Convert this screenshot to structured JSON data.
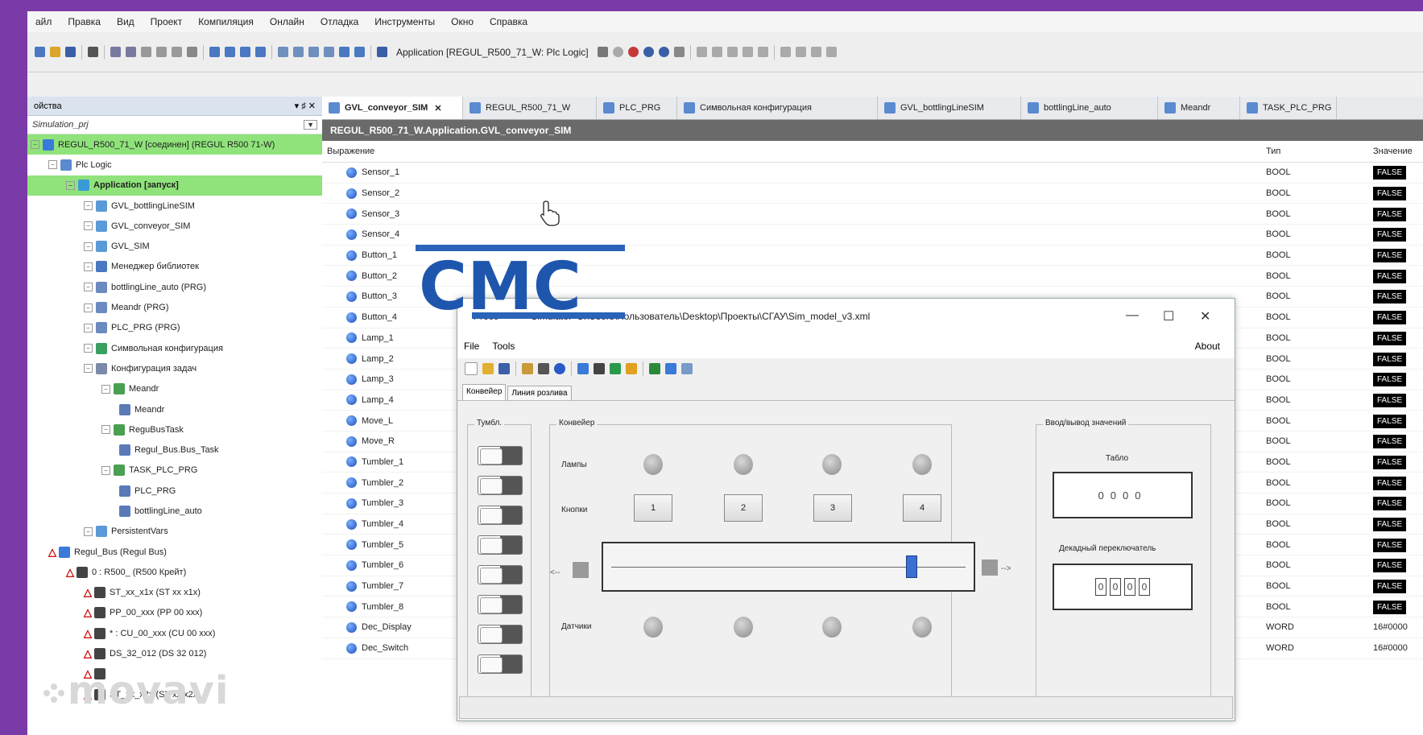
{
  "menu": [
    "айл",
    "Правка",
    "Вид",
    "Проект",
    "Компиляция",
    "Онлайн",
    "Отладка",
    "Инструменты",
    "Окно",
    "Справка"
  ],
  "toolbar": {
    "app_combo": "Application [REGUL_R500_71_W: Plc Logic]"
  },
  "left_panel": {
    "title": "ойства",
    "controls": "▾ ♯ ✕",
    "project": "Simulation_prj",
    "tree": [
      {
        "label": "REGUL_R500_71_W [соединен] (REGUL R500 71-W)",
        "indent": 0,
        "hl": true,
        "bold": false,
        "icon": "device"
      },
      {
        "label": "Plc Logic",
        "indent": 1,
        "hl": false,
        "bold": false,
        "icon": "plc"
      },
      {
        "label": "Application [запуск]",
        "indent": 2,
        "hl": true,
        "bold": true,
        "icon": "gear"
      },
      {
        "label": "GVL_bottlingLineSIM",
        "indent": 3,
        "hl": false,
        "bold": false,
        "icon": "gvl"
      },
      {
        "label": "GVL_conveyor_SIM",
        "indent": 3,
        "hl": false,
        "bold": false,
        "icon": "gvl"
      },
      {
        "label": "GVL_SIM",
        "indent": 3,
        "hl": false,
        "bold": false,
        "icon": "gvl"
      },
      {
        "label": "Менеджер библиотек",
        "indent": 3,
        "hl": false,
        "bold": false,
        "icon": "lib"
      },
      {
        "label": "bottlingLine_auto (PRG)",
        "indent": 3,
        "hl": false,
        "bold": false,
        "icon": "prg"
      },
      {
        "label": "Meandr (PRG)",
        "indent": 3,
        "hl": false,
        "bold": false,
        "icon": "prg"
      },
      {
        "label": "PLC_PRG (PRG)",
        "indent": 3,
        "hl": false,
        "bold": false,
        "icon": "prg"
      },
      {
        "label": "Символьная конфигурация",
        "indent": 3,
        "hl": false,
        "bold": false,
        "icon": "sym"
      },
      {
        "label": "Конфигурация задач",
        "indent": 3,
        "hl": false,
        "bold": false,
        "icon": "task"
      },
      {
        "label": "Meandr",
        "indent": 4,
        "hl": false,
        "bold": false,
        "icon": "taskitem"
      },
      {
        "label": "Meandr",
        "indent": 5,
        "hl": false,
        "bold": false,
        "icon": "call"
      },
      {
        "label": "ReguBusTask",
        "indent": 4,
        "hl": false,
        "bold": false,
        "icon": "taskitem"
      },
      {
        "label": "Regul_Bus.Bus_Task",
        "indent": 5,
        "hl": false,
        "bold": false,
        "icon": "call"
      },
      {
        "label": "TASK_PLC_PRG",
        "indent": 4,
        "hl": false,
        "bold": false,
        "icon": "taskitem"
      },
      {
        "label": "PLC_PRG",
        "indent": 5,
        "hl": false,
        "bold": false,
        "icon": "call"
      },
      {
        "label": "bottlingLine_auto",
        "indent": 5,
        "hl": false,
        "bold": false,
        "icon": "call"
      },
      {
        "label": "PersistentVars",
        "indent": 3,
        "hl": false,
        "bold": false,
        "icon": "gvl"
      },
      {
        "label": "Regul_Bus (Regul Bus)",
        "indent": 1,
        "hl": false,
        "bold": false,
        "icon": "warnbus"
      },
      {
        "label": "0 : R500_ (R500 Крейт)",
        "indent": 2,
        "hl": false,
        "bold": false,
        "icon": "warnmod"
      },
      {
        "label": "ST_xx_x1x (ST xx x1x)",
        "indent": 3,
        "hl": false,
        "bold": false,
        "icon": "warnmod"
      },
      {
        "label": "PP_00_xxx (PP 00 xxx)",
        "indent": 3,
        "hl": false,
        "bold": false,
        "icon": "warnmod"
      },
      {
        "label": "* : CU_00_xxx (CU 00 xxx)",
        "indent": 3,
        "hl": false,
        "bold": false,
        "icon": "warnmod"
      },
      {
        "label": "DS_32_012 (DS 32 012)",
        "indent": 3,
        "hl": false,
        "bold": false,
        "icon": "warnmod"
      },
      {
        "label": "",
        "indent": 3,
        "hl": false,
        "bold": false,
        "icon": "warnmod"
      },
      {
        "label": "ST_xx_x2x (ST xx x2x)",
        "indent": 3,
        "hl": false,
        "bold": false,
        "icon": "warnmod"
      }
    ]
  },
  "tabs": [
    {
      "label": "GVL_conveyor_SIM",
      "active": true,
      "close": "✕",
      "w": 175
    },
    {
      "label": "REGUL_R500_71_W",
      "active": false,
      "close": "",
      "w": 166
    },
    {
      "label": "PLC_PRG",
      "active": false,
      "close": "",
      "w": 100
    },
    {
      "label": "Символьная конфигурация",
      "active": false,
      "close": "",
      "w": 249
    },
    {
      "label": "GVL_bottlingLineSIM",
      "active": false,
      "close": "",
      "w": 178
    },
    {
      "label": "bottlingLine_auto",
      "active": false,
      "close": "",
      "w": 170
    },
    {
      "label": "Meandr",
      "active": false,
      "close": "",
      "w": 102
    },
    {
      "label": "TASK_PLC_PRG",
      "active": false,
      "close": "",
      "w": 120
    }
  ],
  "path": "REGUL_R500_71_W.Application.GVL_conveyor_SIM",
  "columns": {
    "expr": "Выражение",
    "type": "Тип",
    "value": "Значение"
  },
  "variables": [
    {
      "name": "Sensor_1",
      "type": "BOOL",
      "value": "FALSE"
    },
    {
      "name": "Sensor_2",
      "type": "BOOL",
      "value": "FALSE"
    },
    {
      "name": "Sensor_3",
      "type": "BOOL",
      "value": "FALSE"
    },
    {
      "name": "Sensor_4",
      "type": "BOOL",
      "value": "FALSE"
    },
    {
      "name": "Button_1",
      "type": "BOOL",
      "value": "FALSE"
    },
    {
      "name": "Button_2",
      "type": "BOOL",
      "value": "FALSE"
    },
    {
      "name": "Button_3",
      "type": "BOOL",
      "value": "FALSE"
    },
    {
      "name": "Button_4",
      "type": "BOOL",
      "value": "FALSE"
    },
    {
      "name": "Lamp_1",
      "type": "BOOL",
      "value": "FALSE"
    },
    {
      "name": "Lamp_2",
      "type": "BOOL",
      "value": "FALSE"
    },
    {
      "name": "Lamp_3",
      "type": "BOOL",
      "value": "FALSE"
    },
    {
      "name": "Lamp_4",
      "type": "BOOL",
      "value": "FALSE"
    },
    {
      "name": "Move_L",
      "type": "BOOL",
      "value": "FALSE"
    },
    {
      "name": "Move_R",
      "type": "BOOL",
      "value": "FALSE"
    },
    {
      "name": "Tumbler_1",
      "type": "BOOL",
      "value": "FALSE"
    },
    {
      "name": "Tumbler_2",
      "type": "BOOL",
      "value": "FALSE"
    },
    {
      "name": "Tumbler_3",
      "type": "BOOL",
      "value": "FALSE"
    },
    {
      "name": "Tumbler_4",
      "type": "BOOL",
      "value": "FALSE"
    },
    {
      "name": "Tumbler_5",
      "type": "BOOL",
      "value": "FALSE"
    },
    {
      "name": "Tumbler_6",
      "type": "BOOL",
      "value": "FALSE"
    },
    {
      "name": "Tumbler_7",
      "type": "BOOL",
      "value": "FALSE"
    },
    {
      "name": "Tumbler_8",
      "type": "BOOL",
      "value": "FALSE"
    },
    {
      "name": "Dec_Display",
      "type": "WORD",
      "value": "16#0000"
    },
    {
      "name": "Dec_Switch",
      "type": "WORD",
      "value": "16#0000"
    }
  ],
  "sim": {
    "title_prefix": "Proce",
    "title_mid": "Simulator",
    "title_path": "C:\\Users\\Пользователь\\Desktop\\Проекты\\СГАУ\\Sim_model_v3.xml",
    "win_min": "—",
    "win_max": "☐",
    "win_close": "✕",
    "menu": [
      "File",
      "Tools"
    ],
    "about": "About",
    "tabs": [
      "Конвейер",
      "Линия розлива"
    ],
    "groups": {
      "tumbler": "Тумбл.",
      "conveyor": "Конвейер",
      "io": "Ввод/вывод значений"
    },
    "lamps_label": "Лампы",
    "buttons_label": "Кнопки",
    "sensors_label": "Датчики",
    "buttons": [
      "1",
      "2",
      "3",
      "4"
    ],
    "move_left": "<--",
    "move_right": "-->",
    "tablo_label": "Табло",
    "tablo_value": "0000",
    "switch_label": "Декадный переключатель",
    "switch_digits": [
      "0",
      "0",
      "0",
      "0"
    ],
    "slider_position": 0.86
  },
  "logo_text": "СМС",
  "watermark": "movavi"
}
